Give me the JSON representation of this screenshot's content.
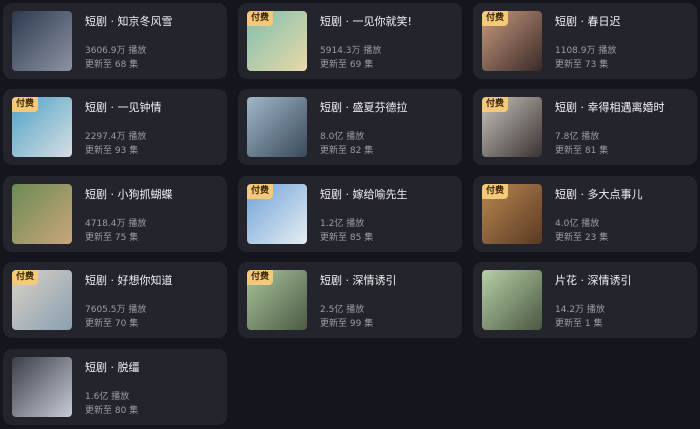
{
  "badge_label": "付费",
  "plays_suffix": "播放",
  "update_prefix": "更新至",
  "update_suffix": "集",
  "dramas": [
    {
      "title": "短剧 · 知京冬风雪",
      "plays": "3606.9万",
      "episodes": "68",
      "paid": false,
      "colors": [
        "#2c3a4e",
        "#8c93a3"
      ]
    },
    {
      "title": "短剧 · 一见你就笑!",
      "plays": "5914.3万",
      "episodes": "69",
      "paid": true,
      "colors": [
        "#7fbfb0",
        "#e8d9a7"
      ]
    },
    {
      "title": "短剧 · 春日迟",
      "plays": "1108.9万",
      "episodes": "73",
      "paid": true,
      "colors": [
        "#c99a7c",
        "#3a2a2a"
      ]
    },
    {
      "title": "短剧 · 一见钟情",
      "plays": "2297.4万",
      "episodes": "93",
      "paid": true,
      "colors": [
        "#4ea3c7",
        "#d7dde3"
      ]
    },
    {
      "title": "短剧 · 盛夏芬德拉",
      "plays": "8.0亿",
      "episodes": "82",
      "paid": false,
      "colors": [
        "#9fb7c9",
        "#3b4a5a"
      ]
    },
    {
      "title": "短剧 · 幸得相遇离婚时",
      "plays": "7.8亿",
      "episodes": "81",
      "paid": true,
      "colors": [
        "#c8c4bd",
        "#3a3232"
      ]
    },
    {
      "title": "短剧 · 小狗抓蝴蝶",
      "plays": "4718.4万",
      "episodes": "75",
      "paid": false,
      "colors": [
        "#6b8b54",
        "#c9a67a"
      ]
    },
    {
      "title": "短剧 · 嫁给喻先生",
      "plays": "1.2亿",
      "episodes": "85",
      "paid": true,
      "colors": [
        "#6fa3d8",
        "#e6edf3"
      ]
    },
    {
      "title": "短剧 · 多大点事儿",
      "plays": "4.0亿",
      "episodes": "23",
      "paid": true,
      "colors": [
        "#b9884f",
        "#5a3a25"
      ]
    },
    {
      "title": "短剧 · 好想你知道",
      "plays": "7605.5万",
      "episodes": "70",
      "paid": true,
      "colors": [
        "#d9d2c6",
        "#8aa0b0"
      ]
    },
    {
      "title": "短剧 · 深情诱引",
      "plays": "2.5亿",
      "episodes": "99",
      "paid": true,
      "colors": [
        "#a9c49a",
        "#4c5b45"
      ]
    },
    {
      "title": "片花 · 深情诱引",
      "plays": "14.2万",
      "episodes": "1",
      "paid": false,
      "colors": [
        "#b7cfa6",
        "#4a5842"
      ]
    },
    {
      "title": "短剧 · 脱缰",
      "plays": "1.6亿",
      "episodes": "80",
      "paid": false,
      "colors": [
        "#3a3e47",
        "#c7ccd4"
      ]
    }
  ]
}
